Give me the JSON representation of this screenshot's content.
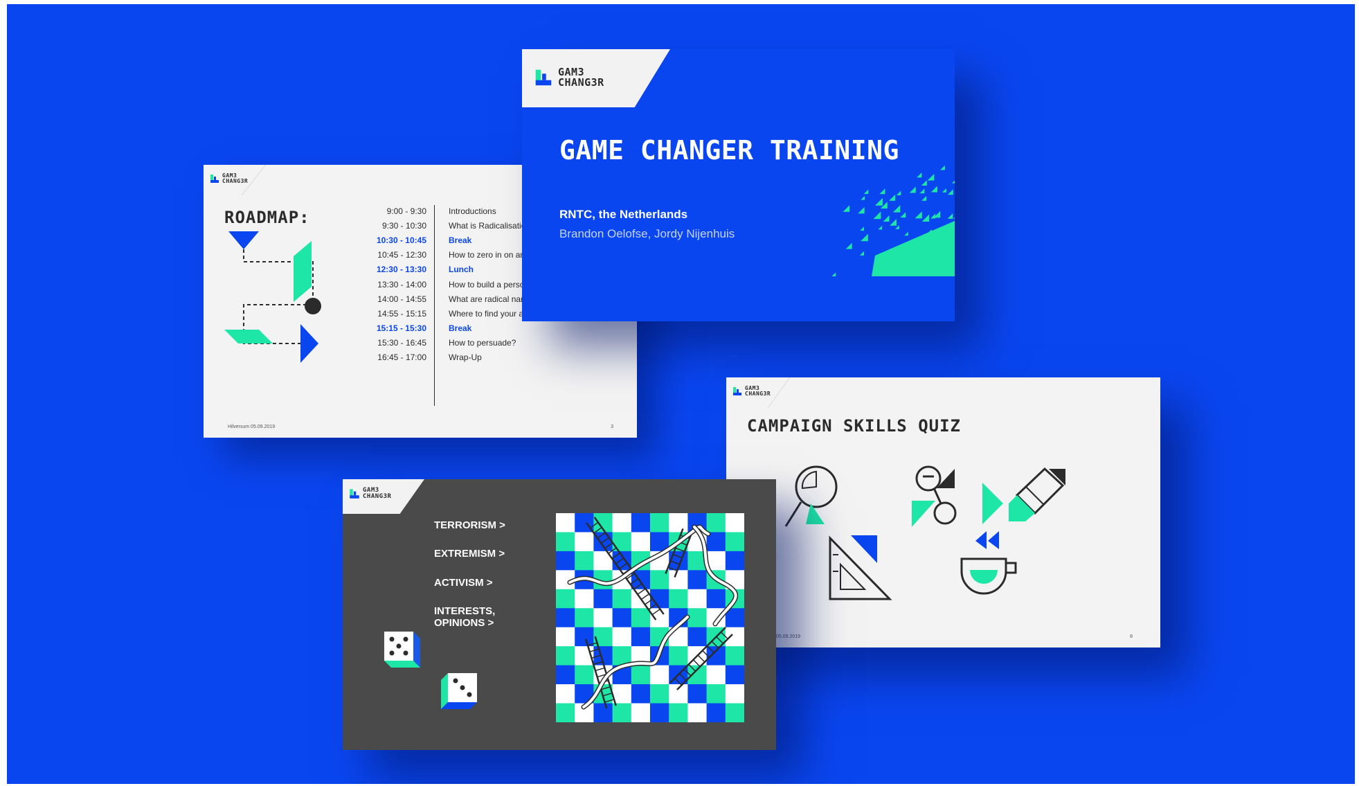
{
  "colors": {
    "brand_blue": "#0a46f0",
    "accent_green": "#1ee6a6",
    "dark_gray": "#4a4a4a",
    "ink": "#2b2b2b",
    "paper": "#f3f3f3"
  },
  "logo": {
    "line1": "GAM3",
    "line2": "CHANG3R"
  },
  "title_slide": {
    "title": "GAME CHANGER TRAINING",
    "location": "RNTC, the Netherlands",
    "presenters": "Brandon Oelofse, Jordy Nijenhuis"
  },
  "roadmap_slide": {
    "title": "ROADMAP:",
    "schedule": [
      {
        "time": "9:00 - 9:30",
        "activity": "Introductions",
        "highlight": false
      },
      {
        "time": "9:30 - 10:30",
        "activity": "What is Radicalisatio",
        "highlight": false
      },
      {
        "time": "10:30 - 10:45",
        "activity": "Break",
        "highlight": true
      },
      {
        "time": "10:45 - 12:30",
        "activity": "How to zero in on an",
        "highlight": false
      },
      {
        "time": "12:30 - 13:30",
        "activity": "Lunch",
        "highlight": true
      },
      {
        "time": "13:30 - 14:00",
        "activity": "How to build a perso",
        "highlight": false
      },
      {
        "time": "14:00 - 14:55",
        "activity": "What are radical nar",
        "highlight": false
      },
      {
        "time": "14:55 - 15:15",
        "activity": "Where to find your a",
        "highlight": false
      },
      {
        "time": "15:15 - 15:30",
        "activity": "Break",
        "highlight": true
      },
      {
        "time": "15:30 - 16:45",
        "activity": "How to persuade?",
        "highlight": false
      },
      {
        "time": "16:45 - 17:00",
        "activity": "Wrap-Up",
        "highlight": false
      }
    ],
    "footer": "Hilversum 05.09.2019",
    "page": "3"
  },
  "quiz_slide": {
    "title": "CAMPAIGN SKILLS QUIZ",
    "footer": "05.09.2019",
    "page": "8",
    "icons": [
      "magnifier-icon",
      "persona-icon",
      "pencil-icon",
      "set-square-icon",
      "cup-icon"
    ]
  },
  "game_slide": {
    "categories": [
      "TERRORISM >",
      "EXTREMISM >",
      "ACTIVISM >",
      "INTERESTS, OPINIONS >"
    ]
  }
}
